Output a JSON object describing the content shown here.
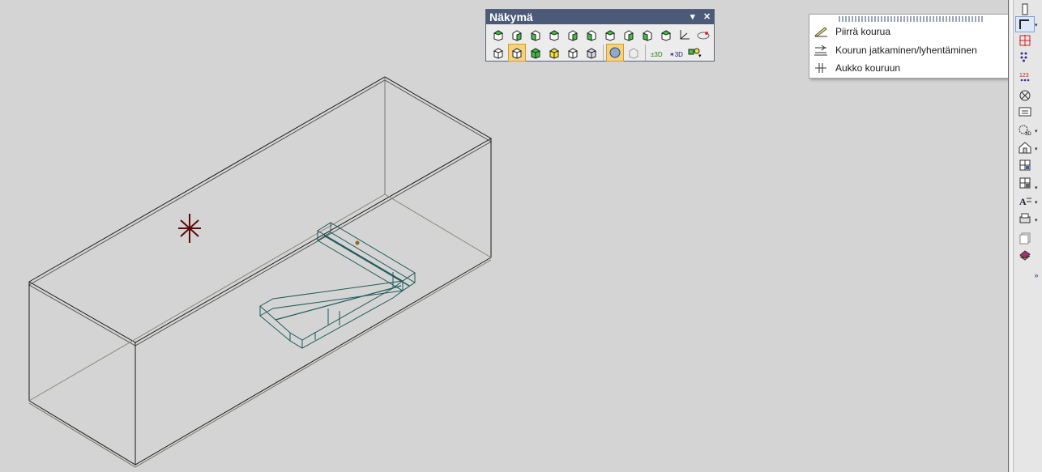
{
  "toolbar": {
    "title": "Näkymä",
    "row1_icons": [
      "view-cube-1-icon",
      "view-cube-2-icon",
      "view-cube-3-icon",
      "view-cube-4-icon",
      "view-cube-5-icon",
      "view-cube-6-icon",
      "view-cube-7-icon",
      "view-cube-8-icon",
      "view-cube-9-icon",
      "view-cube-10-icon",
      "axis-icon",
      "ellipse-eye-icon"
    ],
    "row2_icons": [
      "wireframe-cube-icon",
      "hidden-line-cube-icon",
      "shaded-cube-icon",
      "yellow-cube-icon",
      "outline-cube-icon",
      "stack-cube-icon",
      "sphere-render-icon",
      "ghost-cube-icon",
      "3d-rotate-icon",
      "3d-walk-icon",
      "light-icon"
    ]
  },
  "menu": {
    "items": [
      {
        "label": "Piirrä kourua",
        "icon": "draw-tray-icon"
      },
      {
        "label": "Kourun jatkaminen/lyhentäminen",
        "icon": "extend-tray-icon"
      },
      {
        "label": "Aukko kouruun",
        "icon": "tray-opening-icon"
      }
    ]
  },
  "sidebar": {
    "items": [
      "ruler-icon",
      "tray-corner-icon",
      "red-cross-icon",
      "blue-dots-icon",
      "numbering-icon",
      "circle-x-icon",
      "text-box-icon",
      "gear-3d-icon",
      "house-icon",
      "grid-move-icon",
      "grid-delete-icon",
      "font-a-icon",
      "print-icon",
      "pages-icon",
      "book-icon"
    ],
    "more_label": "»"
  },
  "colors": {
    "background": "#d4d4d4",
    "title_bar": "#4b5a78",
    "tray_lines": "#1f5a5a",
    "box_lines": "#1a1a1a",
    "marker": "#5a0a0a"
  }
}
